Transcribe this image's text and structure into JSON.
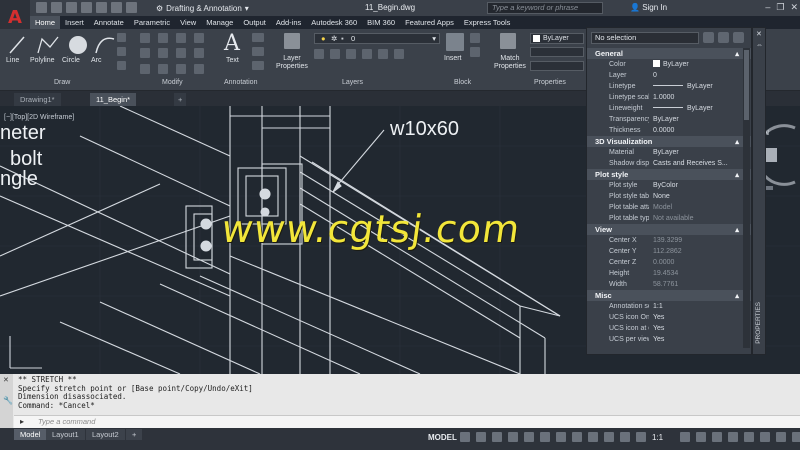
{
  "titlebar": {
    "app_logo": "A",
    "workspace": "Drafting & Annotation",
    "document_title": "11_Begin.dwg",
    "search_placeholder": "Type a keyword or phrase",
    "signin": "Sign In"
  },
  "ribbon_tabs": [
    "Home",
    "Insert",
    "Annotate",
    "Parametric",
    "View",
    "Manage",
    "Output",
    "Add-ins",
    "Autodesk 360",
    "BIM 360",
    "Featured Apps",
    "Express Tools"
  ],
  "ribbon": {
    "draw_tools": [
      "Line",
      "Polyline",
      "Circle",
      "Arc"
    ],
    "text_tool": "Text",
    "layer_properties": [
      "Layer",
      "Properties"
    ],
    "insert_tool": "Insert",
    "match_properties": [
      "Match",
      "Properties"
    ],
    "layer_value": "0",
    "bylayer_value": "ByLayer",
    "panels": [
      "Draw",
      "Modify",
      "Annotation",
      "Layers",
      "Block",
      "Properties"
    ]
  },
  "file_tabs": [
    "Drawing1*",
    "11_Begin*"
  ],
  "viewport_label": "[−][Top][2D Wireframe]",
  "drawing_labels": {
    "callout": "w10x60",
    "left_lines": [
      "neter",
      "bolt",
      "ngle"
    ]
  },
  "watermark": "www.cgtsj.com",
  "properties": {
    "selection": "No selection",
    "side_label": "PROPERTIES",
    "sections": [
      {
        "title": "General",
        "rows": [
          {
            "k": "Color",
            "v": "ByLayer"
          },
          {
            "k": "Layer",
            "v": "0"
          },
          {
            "k": "Linetype",
            "v": "ByLayer"
          },
          {
            "k": "Linetype scale",
            "v": "1.0000"
          },
          {
            "k": "Lineweight",
            "v": "ByLayer"
          },
          {
            "k": "Transparency",
            "v": "ByLayer"
          },
          {
            "k": "Thickness",
            "v": "0.0000"
          }
        ]
      },
      {
        "title": "3D Visualization",
        "rows": [
          {
            "k": "Material",
            "v": "ByLayer"
          },
          {
            "k": "Shadow display",
            "v": "Casts and Receives S..."
          }
        ]
      },
      {
        "title": "Plot style",
        "rows": [
          {
            "k": "Plot style",
            "v": "ByColor"
          },
          {
            "k": "Plot style table",
            "v": "None"
          },
          {
            "k": "Plot table attac...",
            "v": "Model"
          },
          {
            "k": "Plot table type",
            "v": "Not available"
          }
        ]
      },
      {
        "title": "View",
        "rows": [
          {
            "k": "Center X",
            "v": "139.3299"
          },
          {
            "k": "Center Y",
            "v": "112.2862"
          },
          {
            "k": "Center Z",
            "v": "0.0000"
          },
          {
            "k": "Height",
            "v": "19.4534"
          },
          {
            "k": "Width",
            "v": "58.7761"
          }
        ]
      },
      {
        "title": "Misc",
        "rows": [
          {
            "k": "Annotation scale",
            "v": "1:1"
          },
          {
            "k": "UCS icon On",
            "v": "Yes"
          },
          {
            "k": "UCS icon at ori...",
            "v": "Yes"
          },
          {
            "k": "UCS per viewport",
            "v": "Yes"
          }
        ]
      }
    ]
  },
  "command": {
    "history": "** STRETCH **\nSpecify stretch point or [Base point/Copy/Undo/eXit]\nDimension disassociated.\nCommand: *Cancel*",
    "placeholder": "Type a command"
  },
  "status": {
    "layout_tabs": [
      "Model",
      "Layout1",
      "Layout2"
    ],
    "model": "MODEL",
    "scale": "1:1"
  },
  "colors": {
    "watermark": "#f2e63a",
    "drawing_bg": "#212830",
    "linework": "#e8ecf0"
  }
}
